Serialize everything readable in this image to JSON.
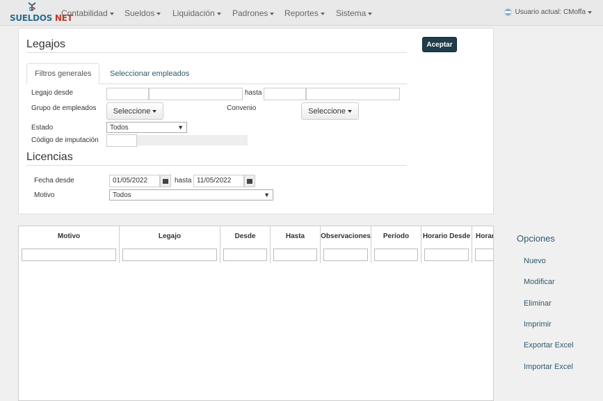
{
  "navbar": {
    "logo": {
      "part1": "SUELDOS",
      "part2": "NET"
    },
    "menu": [
      "Contabilidad",
      "Sueldos",
      "Liquidación",
      "Padrones",
      "Reportes",
      "Sistema"
    ],
    "user_label": "Usuario actual:",
    "user_name": "CMoffa"
  },
  "legajos": {
    "title": "Legajos",
    "accept": "Aceptar",
    "tabs": [
      "Filtros generales",
      "Seleccionar empleados"
    ],
    "legajo_desde": "Legajo desde",
    "hasta": "hasta",
    "grupo": "Grupo de empleados",
    "convenio": "Convenio",
    "seleccione": "Seleccione",
    "estado": "Estado",
    "estado_value": "Todos",
    "codigo": "Código de imputación"
  },
  "licencias": {
    "title": "Licencias",
    "fecha_desde": "Fecha desde",
    "hasta": "hasta",
    "desde_value": "01/05/2022",
    "hasta_value": "11/05/2022",
    "motivo": "Motivo",
    "motivo_value": "Todos"
  },
  "grid": {
    "columns": [
      "Motivo",
      "Legajo",
      "Desde",
      "Hasta",
      "Observaciones",
      "Período",
      "Horario Desde",
      "Horario"
    ]
  },
  "options": {
    "title": "Opciones",
    "items": [
      "Nuevo",
      "Modificar",
      "Eliminar",
      "Imprimir",
      "Exportar Excel",
      "Importar Excel"
    ]
  },
  "colors": {
    "accent": "#2d5a6e",
    "button_dark": "#1f3d4a",
    "logo_blue": "#2c6e8f",
    "logo_red": "#c0392b"
  }
}
